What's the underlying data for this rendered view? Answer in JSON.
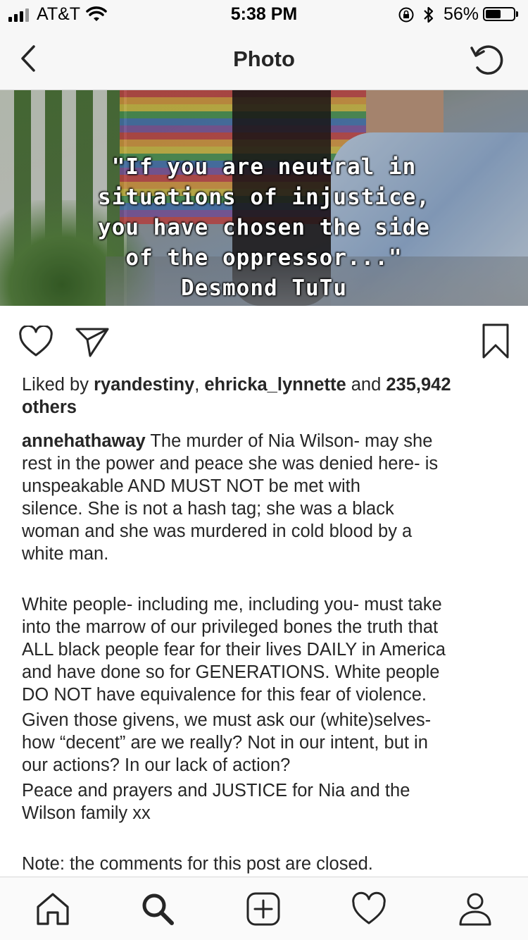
{
  "status_bar": {
    "carrier": "AT&T",
    "time": "5:38 PM",
    "battery_percent": "56%",
    "battery_level": 0.56,
    "icons": [
      "signal-icon",
      "wifi-icon",
      "rotation-lock-icon",
      "bluetooth-icon",
      "battery-icon"
    ]
  },
  "nav": {
    "title": "Photo",
    "back_icon": "chevron-left-icon",
    "refresh_icon": "refresh-icon"
  },
  "photo": {
    "quote_lines": [
      "\"If you are neutral in",
      "situations of injustice,",
      "you have chosen the side",
      "of the oppressor...\"",
      "Desmond TuTu"
    ]
  },
  "actions": {
    "icons": [
      "heart-icon",
      "send-icon",
      "bookmark-icon"
    ]
  },
  "likes": {
    "prefix": "Liked by ",
    "user1": "ryandestiny",
    "separator": ", ",
    "user2": "ehricka_lynnette",
    "and_text": " and ",
    "count": "235,942",
    "suffix": "others"
  },
  "caption": {
    "username": "annehathaway",
    "first_line_text": " The murder of Nia Wilson- may she",
    "lines_p1": [
      "rest in the power and peace she was denied here- is",
      "unspeakable AND MUST NOT be met with",
      "silence.  She is not a hash tag; she was a black",
      "woman and she was murdered in cold blood by a",
      "white man."
    ],
    "lines_p2": [
      "White people- including me, including you- must take",
      "into the marrow of our privileged bones the truth that",
      "ALL black people fear for their lives DAILY in America",
      "and have done so for GENERATIONS.  White people",
      "DO NOT have equivalence for this fear of violence.",
      "Given those givens, we must ask our (white)selves-",
      "how “decent” are we really?  Not in our intent, but in",
      "our actions?  In our lack of action?",
      "Peace and prayers and JUSTICE for Nia and the",
      "Wilson family xx"
    ],
    "note": "Note: the comments for this post are closed."
  },
  "tab_bar": {
    "icons": [
      "home-icon",
      "search-icon",
      "add-post-icon",
      "activity-heart-icon",
      "profile-icon"
    ]
  }
}
